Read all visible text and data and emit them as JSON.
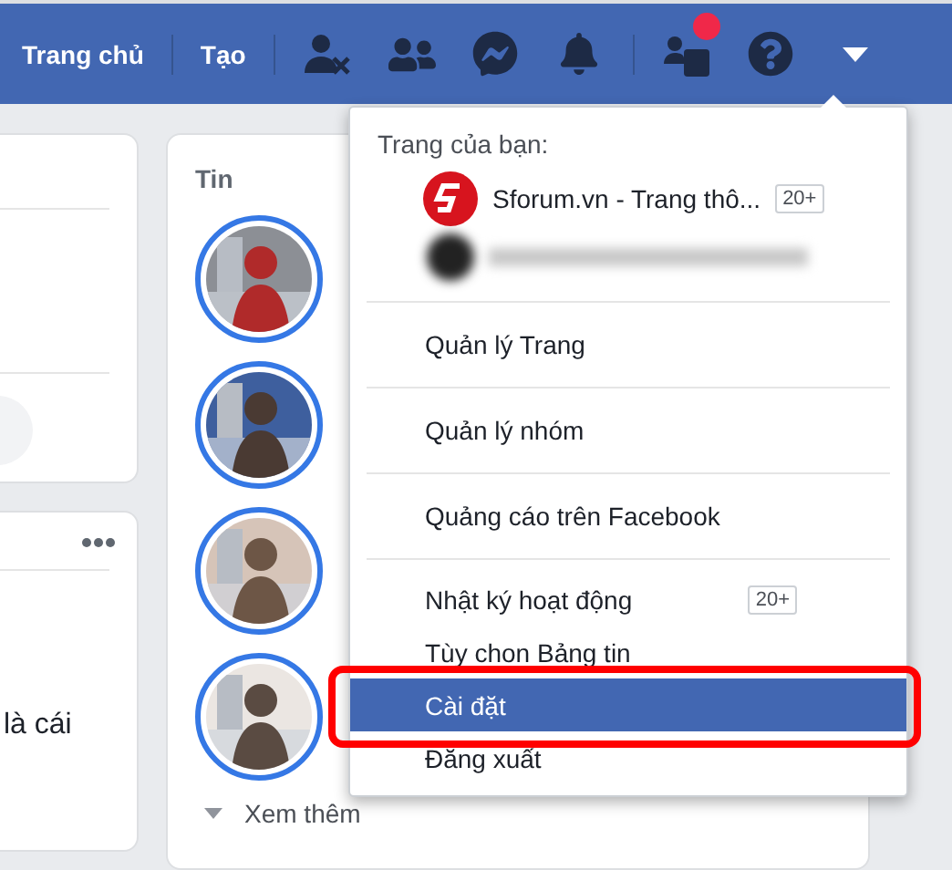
{
  "top_bar": {
    "links": [
      {
        "label": "Trang chủ"
      },
      {
        "label": "Tạo"
      }
    ],
    "icons": [
      {
        "kind": "add-friend"
      },
      {
        "kind": "friends"
      },
      {
        "kind": "messenger"
      },
      {
        "kind": "bell"
      },
      {
        "kind": "pages",
        "badge": true
      },
      {
        "kind": "help"
      },
      {
        "kind": "caret"
      }
    ]
  },
  "left_panel": {
    "post_text": "là cái"
  },
  "stories": {
    "title": "Tin",
    "more": "Xem thêm"
  },
  "menu": {
    "section_label": "Trang của bạn:",
    "pages": [
      {
        "kind": "page",
        "name": "Sforum.vn - Trang thô...",
        "badge": "20+"
      },
      {
        "kind": "blurred"
      }
    ],
    "groups": [
      [
        {
          "label": "Quản lý Trang",
          "selected": false
        }
      ],
      [
        {
          "label": "Quản lý nhóm",
          "selected": false
        }
      ],
      [
        {
          "label": "Quảng cáo trên Facebook",
          "selected": false
        }
      ],
      [
        {
          "label": "Nhật ký hoạt động",
          "badge": "20+",
          "selected": false
        },
        {
          "label": "Tùy chon Bảng tin",
          "selected": false
        },
        {
          "label": "Cài đặt",
          "selected": true,
          "annotated": true
        },
        {
          "label": "Đăng xuất",
          "selected": false
        }
      ]
    ]
  }
}
